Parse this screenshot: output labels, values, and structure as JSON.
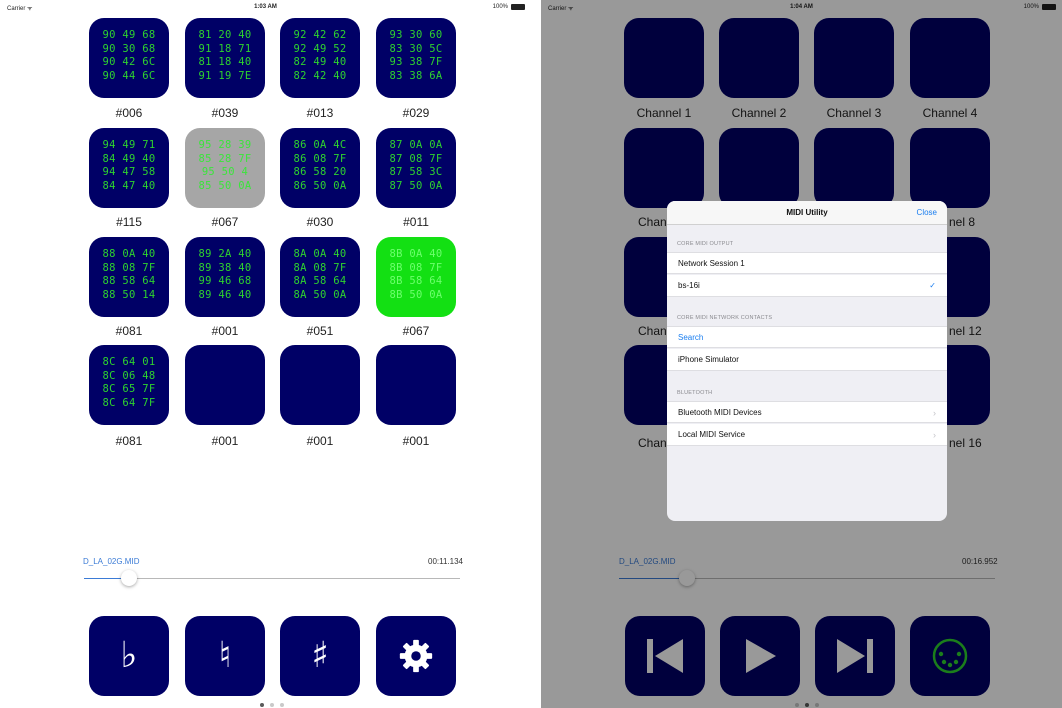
{
  "left_screen": {
    "status": {
      "carrier": "Carrier ᯤ",
      "time": "1:03 AM",
      "battery": "100%"
    },
    "pads": [
      {
        "lines": [
          "90 49 68",
          "90 30 68",
          "90 42 6C",
          "90 44 6C"
        ],
        "label": "#006",
        "state": "normal"
      },
      {
        "lines": [
          "81 20 40",
          "91 18 71",
          "81 18 40",
          "91 19 7E"
        ],
        "label": "#039",
        "state": "normal"
      },
      {
        "lines": [
          "92 42 62",
          "92 49 52",
          "82 49 40",
          "82 42 40"
        ],
        "label": "#013",
        "state": "normal"
      },
      {
        "lines": [
          "93 30 60",
          "83 30 5C",
          "93 38 7F",
          "83 38 6A"
        ],
        "label": "#029",
        "state": "normal"
      },
      {
        "lines": [
          "94 49 71",
          "84 49 40",
          "94 47 58",
          "84 47 40"
        ],
        "label": "#115",
        "state": "normal"
      },
      {
        "lines": [
          "95 28 39",
          "85 28 7F",
          "95 50 4",
          "85 50 0A"
        ],
        "label": "#067",
        "state": "gray"
      },
      {
        "lines": [
          "86 0A 4C",
          "86 08 7F",
          "86 58 20",
          "86 50 0A"
        ],
        "label": "#030",
        "state": "normal"
      },
      {
        "lines": [
          "87 0A 0A",
          "87 08 7F",
          "87 58 3C",
          "87 50 0A"
        ],
        "label": "#011",
        "state": "normal"
      },
      {
        "lines": [
          "88 0A 40",
          "88 08 7F",
          "88 58 64",
          "88 50 14"
        ],
        "label": "#081",
        "state": "normal"
      },
      {
        "lines": [
          "89 2A 40",
          "89 38 40",
          "99 46 68",
          "89 46 40"
        ],
        "label": "#001",
        "state": "normal"
      },
      {
        "lines": [
          "8A 0A 40",
          "8A 08 7F",
          "8A 58 64",
          "8A 50 0A"
        ],
        "label": "#051",
        "state": "normal"
      },
      {
        "lines": [
          "8B 0A 40",
          "8B 08 7F",
          "8B 58 64",
          "8B 50 0A"
        ],
        "label": "#067",
        "state": "green"
      },
      {
        "lines": [
          "8C 64 01",
          "8C 06 48",
          "8C 65 7F",
          "8C 64 7F"
        ],
        "label": "#081",
        "state": "normal"
      },
      {
        "lines": [],
        "label": "#001",
        "state": "normal"
      },
      {
        "lines": [],
        "label": "#001",
        "state": "normal"
      },
      {
        "lines": [],
        "label": "#001",
        "state": "normal"
      }
    ],
    "player": {
      "file_name": "D_LA_02G.MID",
      "time": "00:11.134",
      "progress": 0.12
    },
    "controls": [
      {
        "name": "flat-button",
        "icon": "flat-icon",
        "glyph": "♭"
      },
      {
        "name": "natural-button",
        "icon": "natural-icon",
        "glyph": "♮"
      },
      {
        "name": "sharp-button",
        "icon": "sharp-icon",
        "glyph": "♯"
      },
      {
        "name": "settings-button",
        "icon": "gear-icon",
        "glyph": ""
      }
    ],
    "page_dots": {
      "count": 3,
      "active": 0
    }
  },
  "right_screen": {
    "status": {
      "carrier": "Carrier ᯤ",
      "time": "1:04 AM",
      "battery": "100%"
    },
    "channels": [
      "Channel 1",
      "Channel 2",
      "Channel 3",
      "Channel 4",
      "Chann",
      "nel 8",
      "Chann",
      "nel 12",
      "Chann",
      "nel 16"
    ],
    "player": {
      "file_name": "D_LA_02G.MID",
      "time": "00:16.952",
      "progress": 0.18
    },
    "controls": [
      {
        "name": "skip-back-button",
        "icon": "skip-back-icon"
      },
      {
        "name": "play-button",
        "icon": "play-icon"
      },
      {
        "name": "skip-forward-button",
        "icon": "skip-forward-icon"
      },
      {
        "name": "midi-port-button",
        "icon": "midi-din-icon"
      }
    ],
    "page_dots": {
      "count": 3,
      "active": 1
    },
    "modal": {
      "title": "MIDI Utility",
      "close_label": "Close",
      "sections": [
        {
          "header": "CORE MIDI OUTPUT",
          "rows": [
            {
              "label": "Network Session 1",
              "accessory": ""
            },
            {
              "label": "bs-16i",
              "accessory": "✓"
            }
          ]
        },
        {
          "header": "CORE MIDI NETWORK CONTACTS",
          "rows": [
            {
              "label": "Search",
              "accessory": ""
            },
            {
              "label": "iPhone Simulator",
              "accessory": ""
            }
          ]
        },
        {
          "header": "BLUETOOTH",
          "rows": [
            {
              "label": "Bluetooth MIDI Devices",
              "accessory": "›"
            },
            {
              "label": "Local MIDI Service",
              "accessory": "›"
            }
          ]
        }
      ]
    }
  },
  "colors": {
    "pad": "#000066",
    "led": "#2ed22e",
    "active_pad": "#13e013",
    "selected_pad": "#a6a6a6",
    "accent": "#1a7ef0"
  }
}
